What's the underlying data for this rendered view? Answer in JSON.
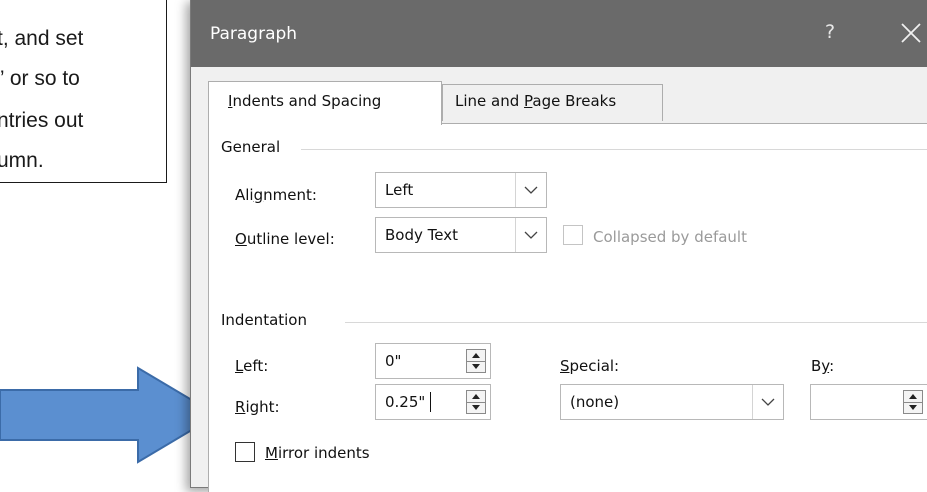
{
  "callout": {
    "lines": [
      "t, and set",
      "” or so to",
      "ntries out",
      "umn."
    ]
  },
  "dialog": {
    "title": "Paragraph",
    "help": "?",
    "tabs": [
      {
        "label": "Indents and Spacing",
        "selected": true
      },
      {
        "label": "Line and Page Breaks",
        "selected": false
      }
    ],
    "general": {
      "heading": "General",
      "alignment": {
        "label": "Alignment:",
        "value": "Left"
      },
      "outline_level": {
        "label": "Outline level:",
        "value": "Body Text"
      },
      "collapsed": {
        "label": "Collapsed by default",
        "checked": false,
        "enabled": false
      }
    },
    "indentation": {
      "heading": "Indentation",
      "left": {
        "label": "Left:",
        "value": "0\""
      },
      "right": {
        "label": "Right:",
        "value": "0.25\""
      },
      "special": {
        "label": "Special:",
        "value": "(none)"
      },
      "by": {
        "label": "By:",
        "value": ""
      },
      "mirror": {
        "label": "Mirror indents",
        "checked": false
      }
    }
  },
  "colors": {
    "titlebar": "#6a6a6a",
    "arrow": "#5b8fd0",
    "arrow_border": "#3b6ba8"
  },
  "icons": {
    "close": "close-icon",
    "dropdown": "chevron-down-icon",
    "spinner": "spinner-arrows-icon",
    "arrow": "right-arrow-icon"
  }
}
